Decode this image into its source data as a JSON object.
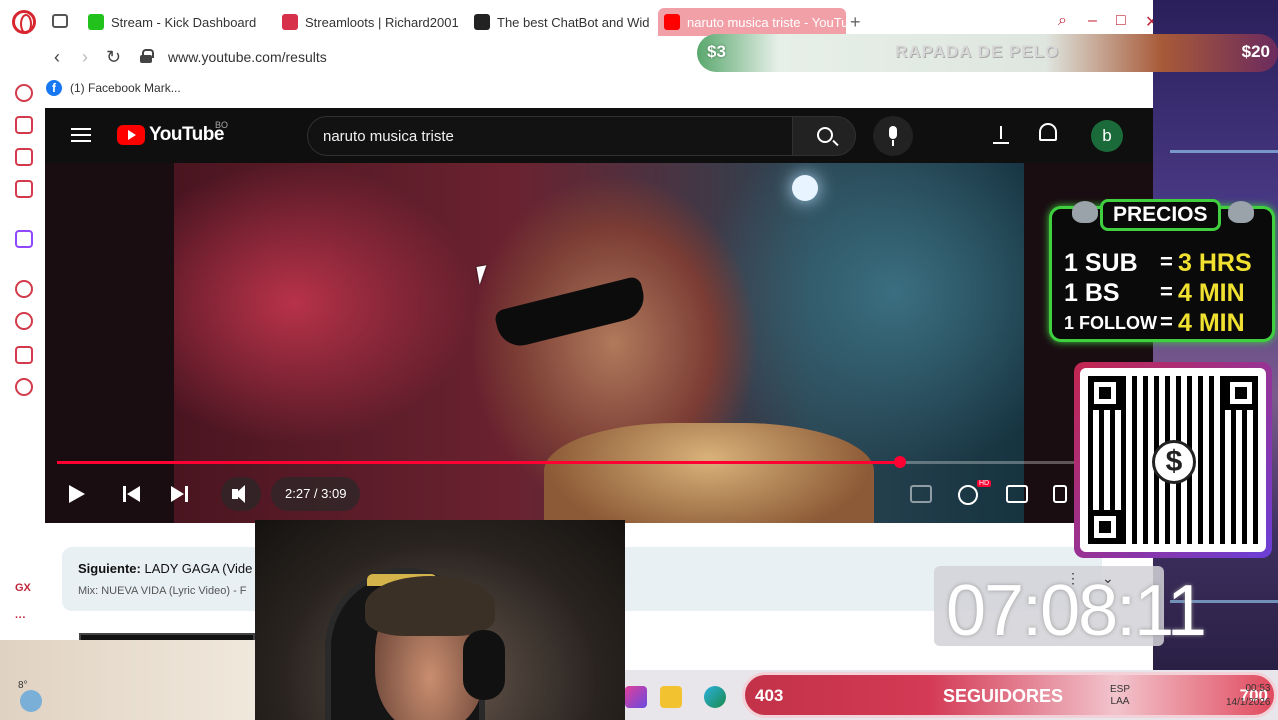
{
  "browser": {
    "tabs": [
      {
        "label": "Stream - Kick Dashboard",
        "color": "#21c21c"
      },
      {
        "label": "Streamloots | Richard2001",
        "color": "#d6304a"
      },
      {
        "label": "The best ChatBot and Wid",
        "color": "#222222"
      },
      {
        "label": "naruto musica triste - YouTube",
        "color": "#ff0000",
        "active": true
      }
    ],
    "url": "www.youtube.com/results",
    "bookmark": "(1) Facebook Mark..."
  },
  "sidebar": {
    "gx_label": "GX",
    "more_label": "···"
  },
  "youtube": {
    "logo_text": "YouTube",
    "country_code": "BO",
    "search_query": "naruto musica triste",
    "avatar_letter": "b",
    "player": {
      "current_time": "2:27",
      "duration": "3:09",
      "time_display": "2:27 / 3:09",
      "progress_fraction": 0.778
    },
    "up_next": {
      "label": "Siguiente:",
      "title": "LADY GAGA (Vide",
      "subtitle": "Mix: NUEVA VIDA (Lyric Video) - F"
    }
  },
  "overlay": {
    "donation_left": "$3",
    "donation_mid": "RAPADA DE PELO",
    "donation_right": "$20",
    "precios": {
      "title": "PRECIOS",
      "rows": [
        {
          "item": "1 SUB",
          "eq": "=",
          "value": "3 HRS"
        },
        {
          "item": "1 BS",
          "eq": "=",
          "value": "4 MIN"
        },
        {
          "item": "1 FOLLOW",
          "eq": "=",
          "value": "4 MIN"
        }
      ]
    },
    "qr_symbol": "$",
    "timer": "07:08:11",
    "followers": {
      "count": "403",
      "label": "SEGUIDORES",
      "goal": "700"
    }
  },
  "taskbar": {
    "temperature": "8°",
    "language": "ESP",
    "keyboard": "LAA",
    "time": "00:53",
    "date": "14/1/2026"
  },
  "colors": {
    "youtube_red": "#ff0000",
    "accent_green": "#3fcf3f",
    "price_yellow": "#f0e030"
  }
}
